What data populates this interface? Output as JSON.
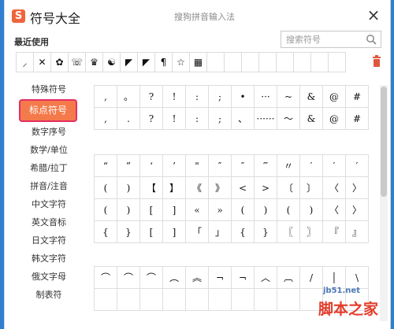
{
  "app": {
    "logo": "S",
    "title": "符号大全",
    "input_method": "搜狗拼音输入法",
    "close": "×"
  },
  "recent": {
    "title": "最近使用",
    "symbols": [
      "⸝",
      "✕",
      "✿",
      "☏",
      "♛",
      "☯",
      "◤",
      "◤",
      "¶",
      "☆",
      "▦",
      "",
      "",
      "",
      "",
      "",
      "",
      "",
      ""
    ]
  },
  "search": {
    "placeholder": "搜索符号",
    "value": ""
  },
  "sidebar": {
    "items": [
      {
        "label": "特殊符号"
      },
      {
        "label": "标点符号",
        "active": true
      },
      {
        "label": "数字序号"
      },
      {
        "label": "数学/单位"
      },
      {
        "label": "希腊/拉丁"
      },
      {
        "label": "拼音/注音"
      },
      {
        "label": "中文字符"
      },
      {
        "label": "英文音标"
      },
      {
        "label": "日文字符"
      },
      {
        "label": "韩文字符"
      },
      {
        "label": "俄文字母"
      },
      {
        "label": "制表符"
      }
    ]
  },
  "panels": [
    {
      "name": "basic-punctuation",
      "rows": [
        [
          ",",
          "。",
          "?",
          "!",
          ":",
          ";",
          "•",
          "···",
          "~",
          "&",
          "@",
          "#"
        ],
        [
          ",",
          ".",
          "?",
          "!",
          ":",
          ";",
          "、",
          "······",
          "～",
          "&",
          "@",
          "#"
        ]
      ]
    },
    {
      "name": "quotes-brackets",
      "rows": [
        [
          "“",
          "”",
          "‘",
          "’",
          "\"",
          "″",
          "″",
          "‴",
          "〃",
          "′",
          "′",
          "′"
        ],
        [
          "(",
          ")",
          "【",
          "】",
          "《",
          "》",
          "<",
          ">",
          "〔",
          "〕",
          "〈",
          "〉"
        ],
        [
          "(",
          ")",
          "[",
          "]",
          "«",
          "»",
          "(",
          ")",
          "(",
          ")",
          "〈",
          "〉"
        ],
        [
          "{",
          "}",
          "[",
          "]",
          "「",
          "」",
          "{",
          "}",
          "〖",
          "〗",
          "『",
          "』"
        ]
      ]
    },
    {
      "name": "lines",
      "rows": [
        [
          "⌒",
          "⌒",
          "⌒",
          "︵",
          "︽",
          "¬",
          "¬",
          "︿",
          "︹",
          "/",
          "│",
          "\\"
        ],
        [
          "",
          "",
          "",
          "",
          "",
          "",
          "",
          "",
          "",
          "",
          "",
          ""
        ]
      ]
    }
  ],
  "watermark": {
    "url": "jb51.net",
    "text": "脚本之家"
  },
  "colors": {
    "accent": "#f47a4b",
    "active_border": "#e32f65",
    "logo": "#f0643c",
    "frame": "#2f7fd0"
  }
}
